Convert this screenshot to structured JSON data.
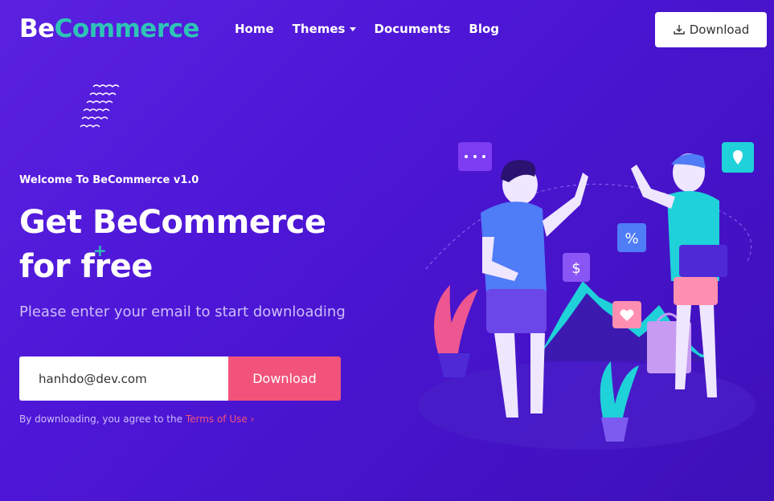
{
  "brand": {
    "part1": "Be",
    "part2": "Commerce"
  },
  "nav": {
    "items": [
      "Home",
      "Themes",
      "Documents",
      "Blog"
    ],
    "download_label": "Download"
  },
  "hero": {
    "eyebrow": "Welcome To BeCommerce v1.0",
    "title_line1": "Get BeCommerce",
    "title_line2": "for free",
    "subtitle": "Please enter your email to start downloading",
    "email_value": "hanhdo@dev.com",
    "button_label": "Download",
    "terms_text": "By downloading, you agree to the ",
    "terms_link": "Terms of Use",
    "illustration_badges": [
      "%",
      "$"
    ]
  },
  "colors": {
    "accent_teal": "#2ec4b6",
    "accent_pink": "#f2537a",
    "bg_purple": "#5a21e0"
  }
}
